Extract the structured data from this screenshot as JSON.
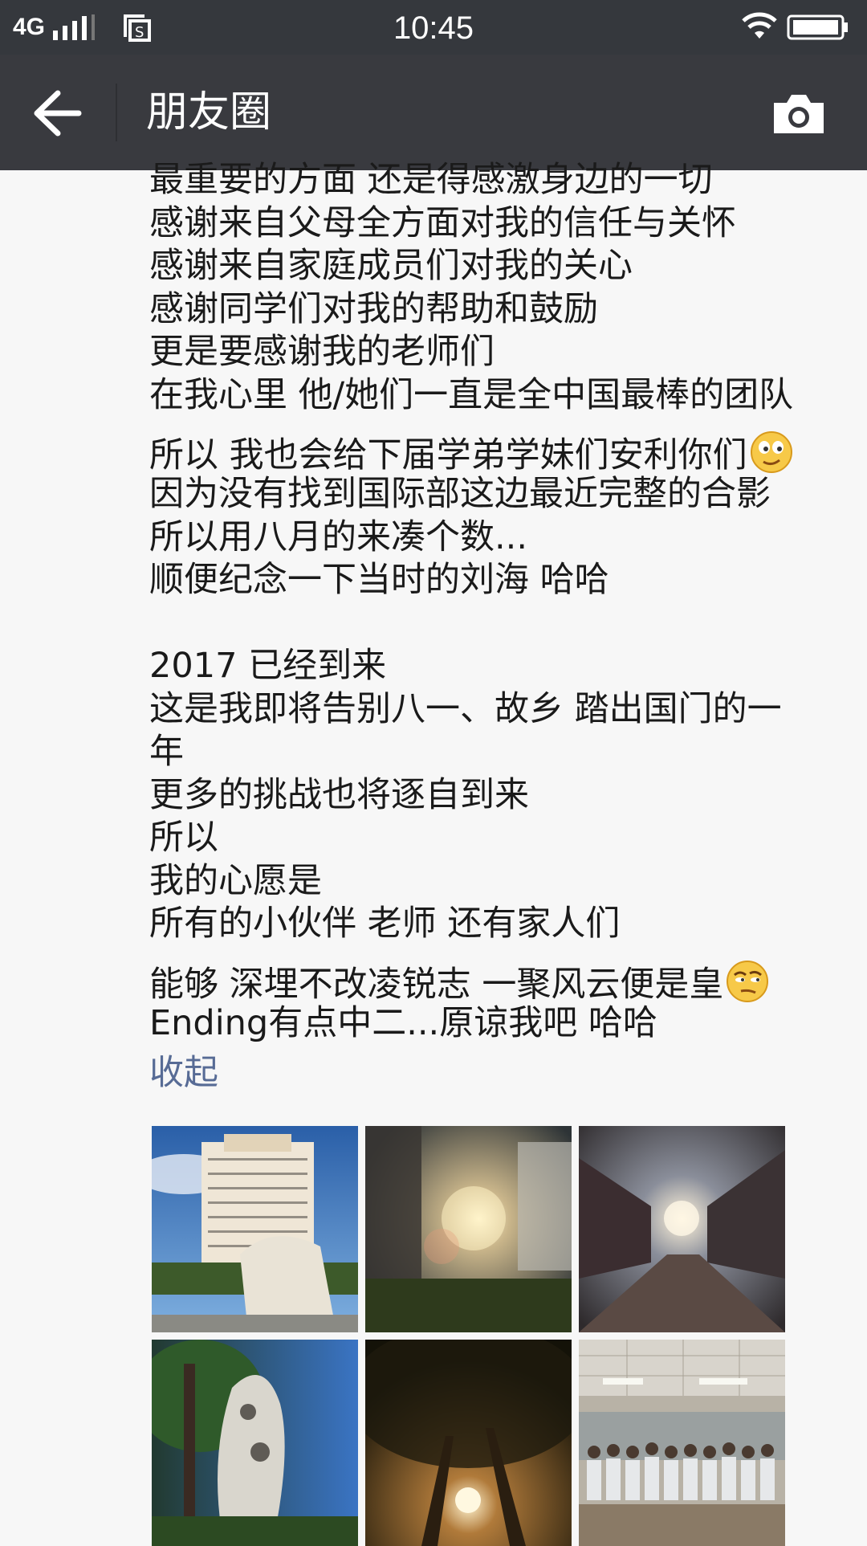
{
  "status_bar": {
    "network": "4G",
    "time": "10:45",
    "icons": [
      "signal-icon",
      "screenshot-icon",
      "wifi-icon",
      "battery-icon"
    ]
  },
  "header": {
    "title": "朋友圈",
    "back_icon": "back-arrow-icon",
    "camera_icon": "camera-icon"
  },
  "post": {
    "lines": [
      "最重要的方面 还是得感激身边的一切",
      "感谢来自父母全方面对我的信任与关怀",
      "感谢来自家庭成员们对我的关心",
      "感谢同学们对我的帮助和鼓励",
      "更是要感谢我的老师们",
      "在我心里 他/她们一直是全中国最棒的团队",
      "所以 我也会给下届学弟学妹们安利你们",
      "因为没有找到国际部这边最近完整的合影",
      "所以用八月的来凑个数...",
      "顺便纪念一下当时的刘海 哈哈",
      "",
      "2017 已经到来",
      "这是我即将告别八一、故乡 踏出国门的一",
      "年",
      "更多的挑战也将逐自到来",
      "所以",
      "我的心愿是",
      "所有的小伙伴 老师 还有家人们",
      "能够 深埋不改凌锐志 一聚风云便是皇",
      "Ending有点中二...原谅我吧 哈哈"
    ],
    "collapse_label": "收起"
  },
  "photos": [
    {
      "name": "photo-building-monument"
    },
    {
      "name": "photo-sunset-courtyard"
    },
    {
      "name": "photo-sunset-street"
    },
    {
      "name": "photo-rock-garden"
    },
    {
      "name": "photo-sun-through-trees"
    },
    {
      "name": "photo-class-group"
    }
  ],
  "colors": {
    "status_bar": "#35383d",
    "header": "#393a3f",
    "background": "#f7f7f7",
    "link": "#576b95"
  }
}
